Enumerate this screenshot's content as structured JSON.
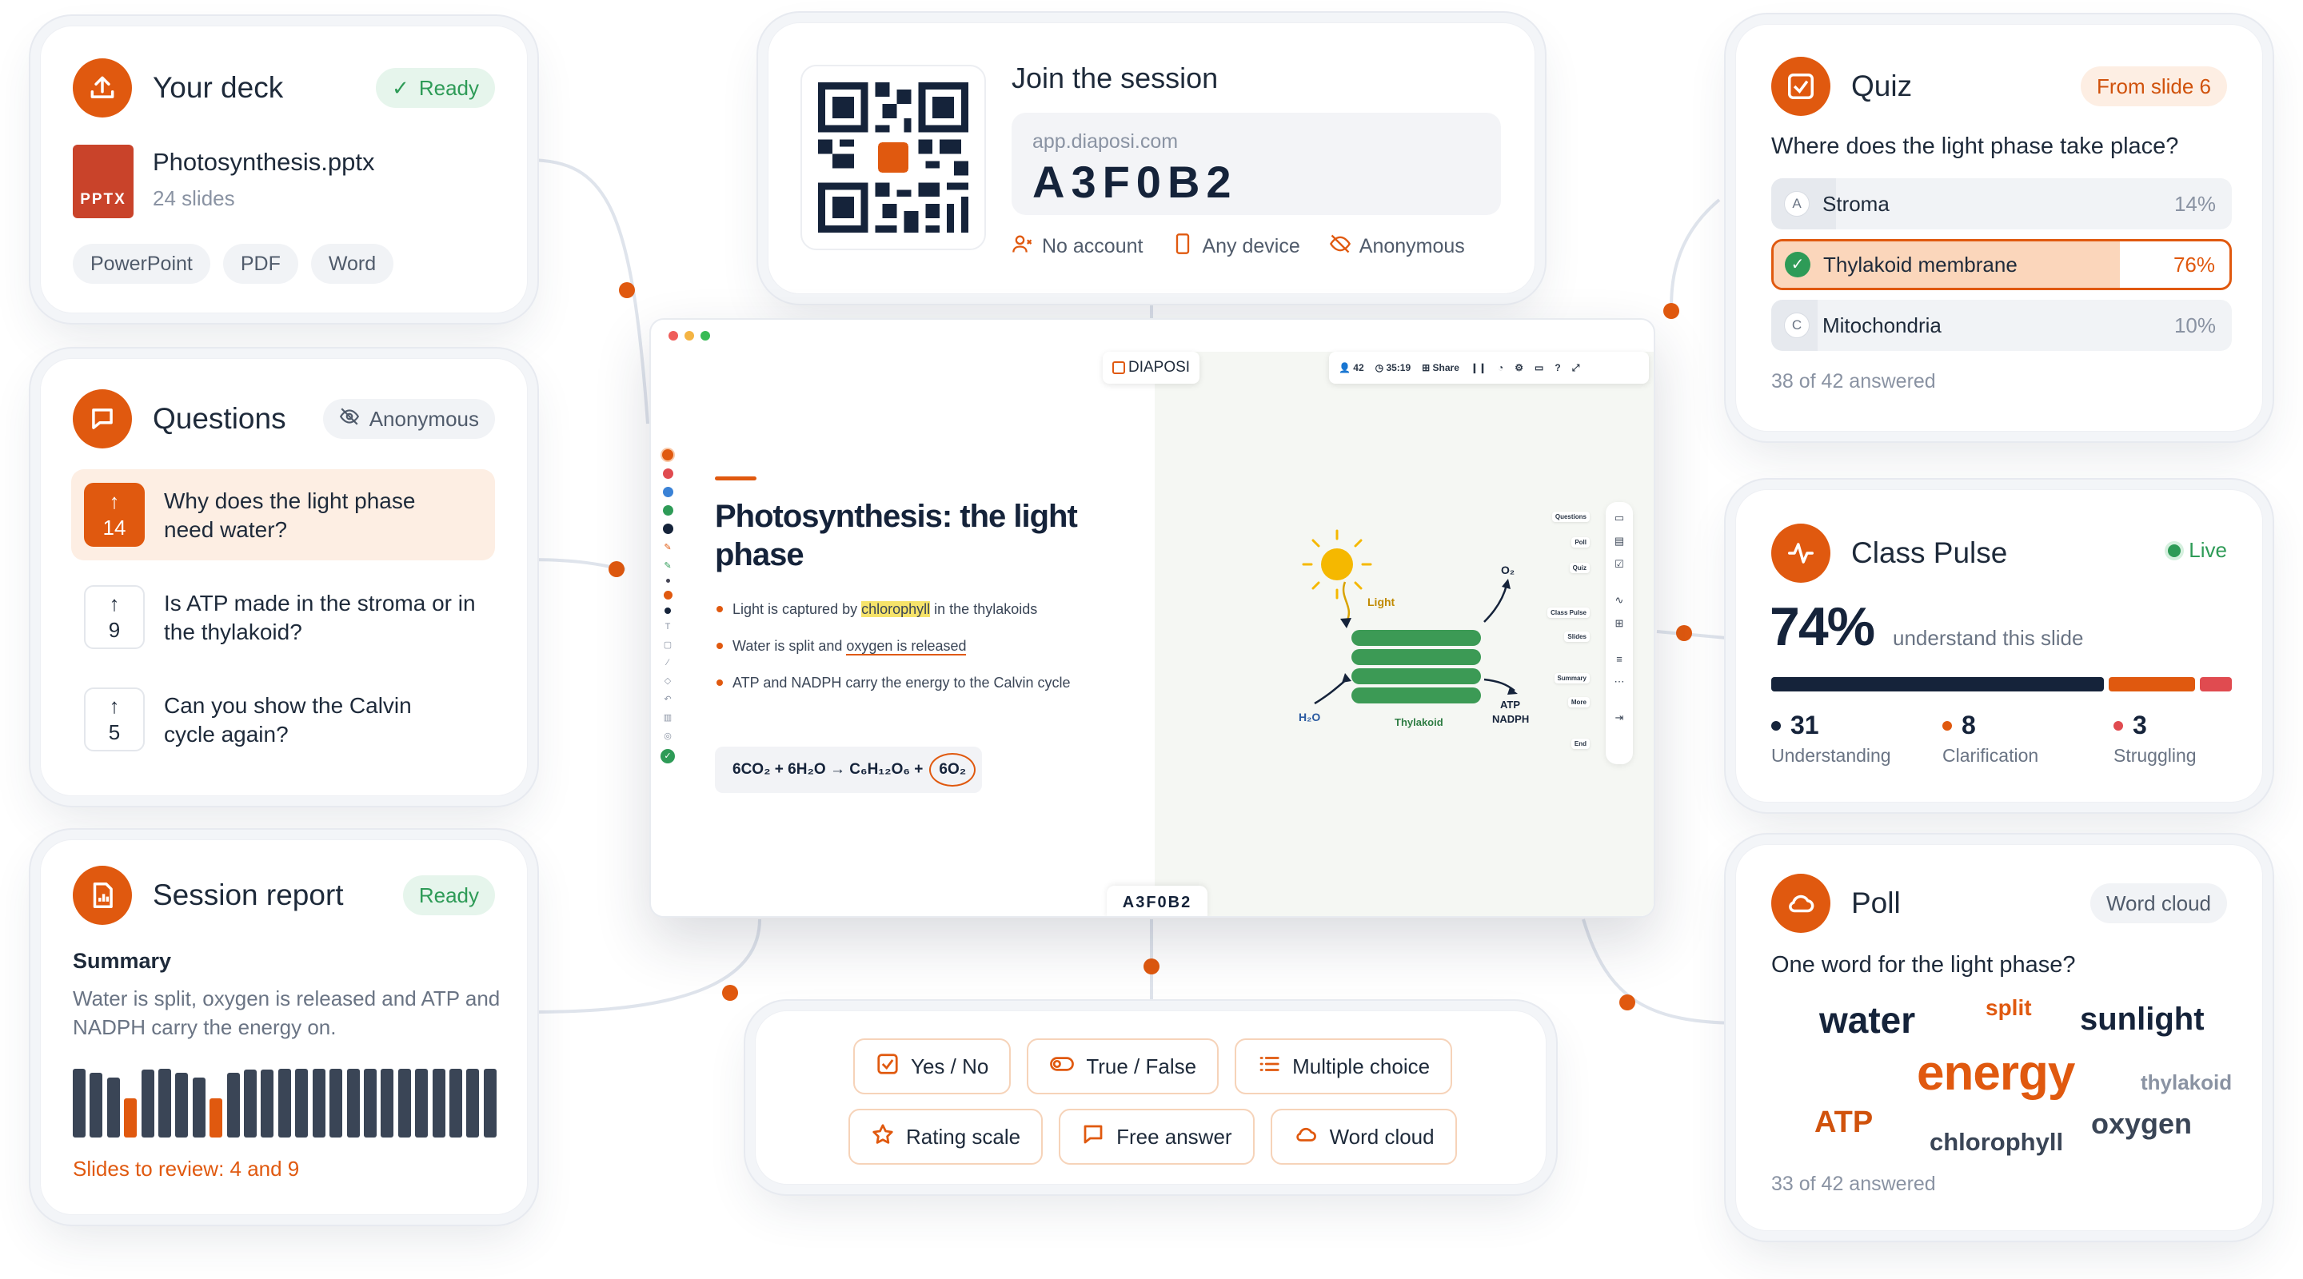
{
  "colors": {
    "accent": "#e0590f",
    "ready": "#2e9b57",
    "navy": "#15233a",
    "red": "#e04b50"
  },
  "deck": {
    "title": "Your deck",
    "status": "Ready",
    "file_badge": "PPTX",
    "file_name": "Photosynthesis.pptx",
    "file_meta": "24 slides",
    "formats": [
      "PowerPoint",
      "PDF",
      "Word"
    ]
  },
  "questions": {
    "title": "Questions",
    "mode": "Anonymous",
    "items": [
      {
        "votes": "14",
        "text": "Why does the light phase need water?"
      },
      {
        "votes": "9",
        "text": "Is ATP made in the stroma or in the thylakoid?"
      },
      {
        "votes": "5",
        "text": "Can you show the Calvin cycle again?"
      }
    ]
  },
  "report": {
    "title": "Session report",
    "status": "Ready",
    "summary_label": "Summary",
    "summary": "Water is split, oxygen is released and ATP and NADPH carry the energy on.",
    "review": "Slides to review: 4 and 9",
    "bars": [
      0.92,
      0.86,
      0.8,
      0.52,
      0.9,
      0.92,
      0.86,
      0.8,
      0.52,
      0.86,
      0.9,
      0.9,
      0.92,
      0.92,
      0.92,
      0.92,
      0.92,
      0.92,
      0.92,
      0.92,
      0.92,
      0.92,
      0.92,
      0.92,
      0.92
    ],
    "highlight_bars": [
      3,
      8
    ]
  },
  "join": {
    "title": "Join the session",
    "url": "app.diaposi.com",
    "code": "A3F0B2",
    "features": [
      "No account",
      "Any device",
      "Anonymous"
    ]
  },
  "presenter": {
    "logo": "DIAPOSI",
    "participants": "42",
    "timer": "35:19",
    "share": "Share",
    "slide_title": "Photosynthesis: the light phase",
    "bullets": [
      {
        "pre": "Light is captured by ",
        "mark": "chlorophyll",
        "post": " in the thylakoids"
      },
      {
        "pre": "Water is split and ",
        "mark": "oxygen is released",
        "post": ""
      },
      {
        "pre": "ATP and NADPH carry the energy to the Calvin cycle",
        "mark": "",
        "post": ""
      }
    ],
    "equation": "6CO₂ + 6H₂O → C₆H₁₂O₆ + 6O₂",
    "eq_main": "6CO₂ + 6H₂O → C₆H₁₂O₆ +",
    "eq_circle": "6O₂",
    "diagram": {
      "light": "Light",
      "o2": "O₂",
      "h2o": "H₂O",
      "thylakoid": "Thylakoid",
      "atp": "ATP",
      "nadph": "NADPH"
    },
    "side_menu": [
      "Questions",
      "Poll",
      "Quiz",
      "Class Pulse",
      "Slides",
      "Summary",
      "More",
      "End"
    ],
    "code_tab": "A3F0B2"
  },
  "activities": {
    "row1": [
      "Yes / No",
      "True / False",
      "Multiple choice"
    ],
    "row2": [
      "Rating scale",
      "Free answer",
      "Word cloud"
    ]
  },
  "quiz": {
    "title": "Quiz",
    "badge": "From slide 6",
    "question": "Where does the light phase take place?",
    "options": [
      {
        "letter": "A",
        "label": "Stroma",
        "pct": "14%",
        "value": 14
      },
      {
        "letter": "B",
        "label": "Thylakoid membrane",
        "pct": "76%",
        "value": 76,
        "correct": true
      },
      {
        "letter": "C",
        "label": "Mitochondria",
        "pct": "10%",
        "value": 10
      }
    ],
    "answered": "38 of 42 answered"
  },
  "pulse": {
    "title": "Class Pulse",
    "status": "Live",
    "pct": "74%",
    "caption": "understand this slide",
    "stats": [
      {
        "value": "31",
        "label": "Understanding",
        "color": "#15233a",
        "n": 31
      },
      {
        "value": "8",
        "label": "Clarification",
        "color": "#e0590f",
        "n": 8
      },
      {
        "value": "3",
        "label": "Struggling",
        "color": "#e04b50",
        "n": 3
      }
    ]
  },
  "poll": {
    "title": "Poll",
    "type": "Word cloud",
    "question": "One word for the light phase?",
    "words": [
      "water",
      "split",
      "sunlight",
      "energy",
      "thylakoid",
      "ATP",
      "oxygen",
      "chlorophyll"
    ],
    "answered": "33 of 42 answered"
  }
}
